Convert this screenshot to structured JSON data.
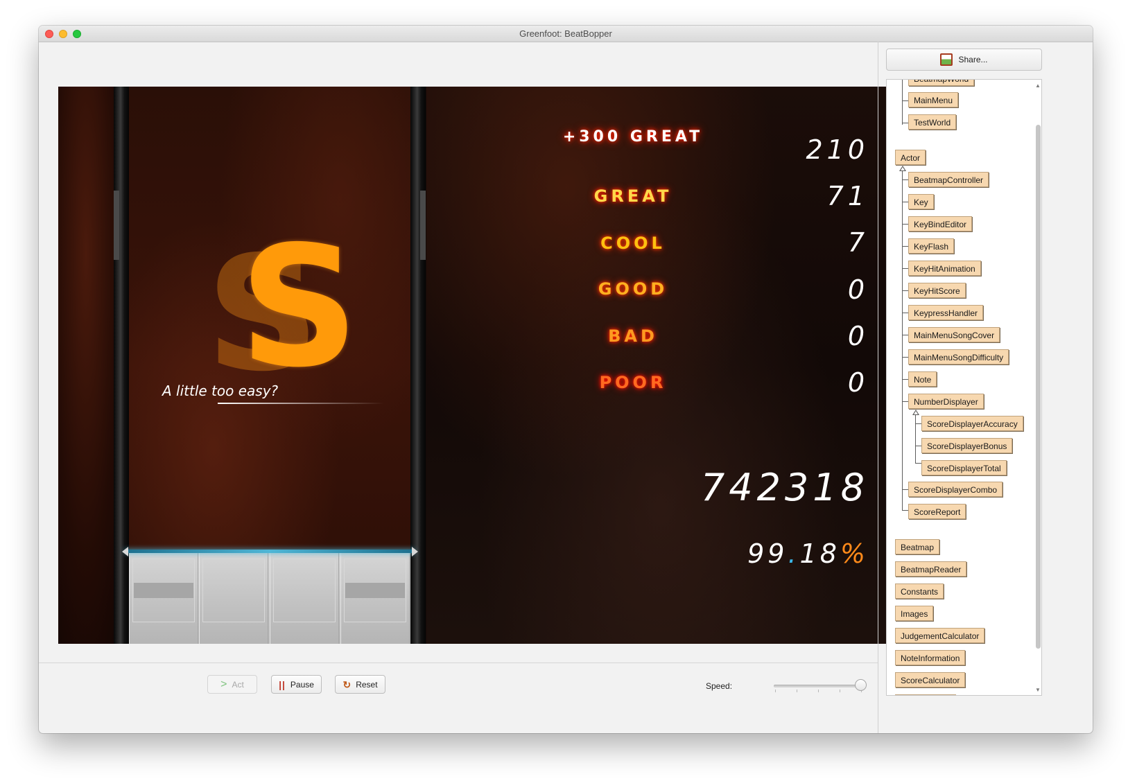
{
  "window": {
    "title": "Greenfoot: BeatBopper"
  },
  "game": {
    "grade": "S",
    "comment": "A little too easy?",
    "judgements": [
      {
        "label": "+300 GREAT",
        "count": "210"
      },
      {
        "label": "GREAT",
        "count": "71"
      },
      {
        "label": "COOL",
        "count": "7"
      },
      {
        "label": "GOOD",
        "count": "0"
      },
      {
        "label": "BAD",
        "count": "0"
      },
      {
        "label": "POOR",
        "count": "0"
      }
    ],
    "total_score": "742318",
    "accuracy": {
      "whole": "99",
      "dot": ".",
      "decimal": "18",
      "symbol": "%"
    }
  },
  "controls": {
    "act": "Act",
    "pause": "Pause",
    "reset": "Reset",
    "speed_label": "Speed:",
    "speed_level": 1.0
  },
  "sidebar": {
    "share": "Share...",
    "world_classes": [
      "BeatmapWorld",
      "MainMenu",
      "TestWorld"
    ],
    "actor_root": "Actor",
    "actor_classes": [
      "BeatmapController",
      "Key",
      "KeyBindEditor",
      "KeyFlash",
      "KeyHitAnimation",
      "KeyHitScore",
      "KeypressHandler",
      "MainMenuSongCover",
      "MainMenuSongDifficulty",
      "Note",
      "NumberDisplayer"
    ],
    "number_displayer_subclasses": [
      "ScoreDisplayerAccuracy",
      "ScoreDisplayerBonus",
      "ScoreDisplayerTotal"
    ],
    "actor_classes_after": [
      "ScoreDisplayerCombo",
      "ScoreReport"
    ],
    "other_classes": [
      "Beatmap",
      "BeatmapReader",
      "Constants",
      "Images",
      "JudgementCalculator",
      "NoteInformation",
      "ScoreCalculator"
    ]
  },
  "colors": {
    "class_box": "#f7d8b0",
    "grade": "#ff9a0a",
    "accuracy_dot": "#3bb6e8",
    "accuracy_percent": "#ff8a1a"
  }
}
